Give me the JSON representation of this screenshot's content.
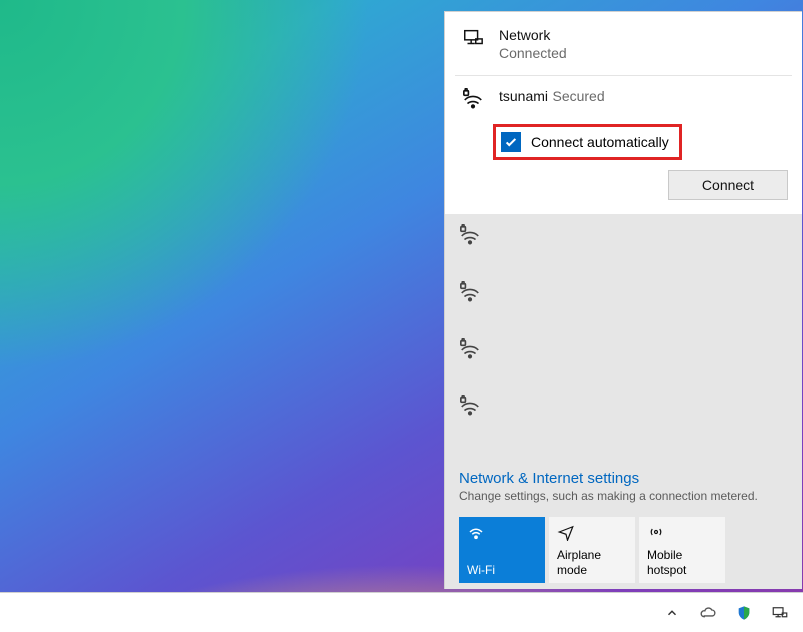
{
  "current_network": {
    "title": "Network",
    "status": "Connected"
  },
  "selected_network": {
    "ssid": "tsunami",
    "security": "Secured",
    "auto_connect_label": "Connect automatically",
    "auto_connect_checked": true,
    "connect_button": "Connect"
  },
  "other_networks_count": 4,
  "footer": {
    "settings_link": "Network & Internet settings",
    "settings_desc": "Change settings, such as making a connection metered."
  },
  "tiles": {
    "wifi": "Wi-Fi",
    "airplane": "Airplane mode",
    "hotspot": "Mobile hotspot"
  },
  "highlight": {
    "target": "connect-automatically-checkbox",
    "color": "#e02424"
  }
}
